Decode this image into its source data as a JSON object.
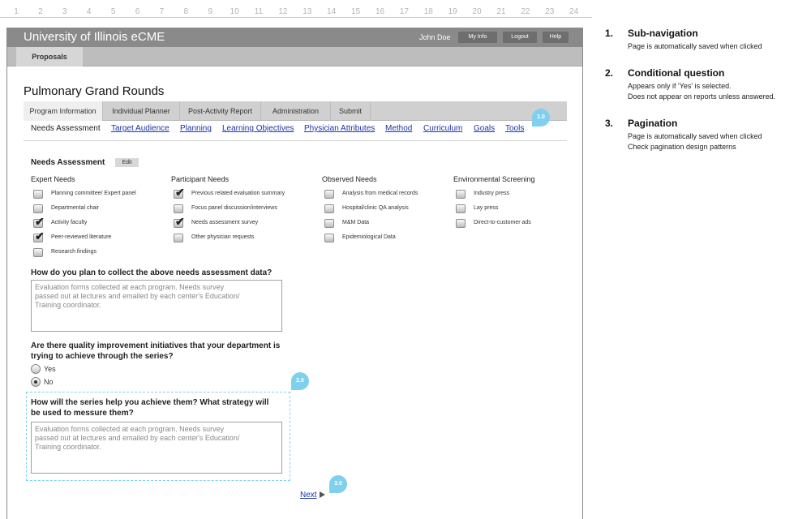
{
  "ruler": [
    "1",
    "2",
    "3",
    "4",
    "5",
    "6",
    "7",
    "8",
    "9",
    "10",
    "11",
    "12",
    "13",
    "14",
    "15",
    "16",
    "17",
    "18",
    "19",
    "20",
    "21",
    "22",
    "23",
    "24"
  ],
  "app": {
    "title": "University of Illinois eCME",
    "user": "John Doe",
    "buttons": [
      "My Info",
      "Logout",
      "Help"
    ],
    "section_tab": "Proposals"
  },
  "page_title": "Pulmonary Grand Rounds",
  "main_tabs": [
    {
      "label": "Program Information",
      "active": true
    },
    {
      "label": "Individual Planner",
      "active": false
    },
    {
      "label": "Post-Activity Report",
      "active": false
    },
    {
      "label": "Administration",
      "active": false
    },
    {
      "label": "Submit",
      "active": false
    }
  ],
  "sub_nav": [
    {
      "label": "Needs Assessment",
      "current": true
    },
    {
      "label": "Target Audience",
      "current": false
    },
    {
      "label": "Planning",
      "current": false
    },
    {
      "label": "Learning Objectives",
      "current": false
    },
    {
      "label": "Physician Attributes",
      "current": false
    },
    {
      "label": "Method",
      "current": false
    },
    {
      "label": "Curriculum",
      "current": false
    },
    {
      "label": "Goals",
      "current": false
    },
    {
      "label": "Tools",
      "current": false
    }
  ],
  "needs": {
    "title": "Needs Assessment",
    "edit_label": "Edit",
    "columns": [
      {
        "header": "Expert Needs",
        "items": [
          {
            "label": "Planning committee/ Expert panel",
            "checked": false
          },
          {
            "label": "Departmental chair",
            "checked": false
          },
          {
            "label": "Activity faculty",
            "checked": true
          },
          {
            "label": "Peer-reviewed literature",
            "checked": true
          },
          {
            "label": "Research findings",
            "checked": false
          }
        ]
      },
      {
        "header": "Participant Needs",
        "items": [
          {
            "label": "Previous related evaluation summary",
            "checked": true
          },
          {
            "label": "Focus panel discussion/interviews",
            "checked": false
          },
          {
            "label": "Needs assessment survey",
            "checked": true
          },
          {
            "label": "Other physician requests",
            "checked": false
          }
        ]
      },
      {
        "header": "Observed Needs",
        "items": [
          {
            "label": "Analysis from medical records",
            "checked": false
          },
          {
            "label": "Hospital/clinic QA analysis",
            "checked": false
          },
          {
            "label": "M&M Data",
            "checked": false
          },
          {
            "label": "Epidemiological Data",
            "checked": false
          }
        ]
      },
      {
        "header": "Environmental Screening",
        "items": [
          {
            "label": "Industry press",
            "checked": false
          },
          {
            "label": "Lay press",
            "checked": false
          },
          {
            "label": "Direct-to-customer ads",
            "checked": false
          }
        ]
      }
    ]
  },
  "q1": {
    "question": "How do you plan to collect the above needs assessment data?",
    "answer": "Evaluation forms collected at each program. Needs survey\npassed out at lectures and emailed by each center's Education/\nTraining coordinator."
  },
  "q2": {
    "question": "Are there quality improvement initiatives that your department is\ntrying to achieve through the series?",
    "options": [
      {
        "label": "Yes",
        "selected": false
      },
      {
        "label": "No",
        "selected": true
      }
    ]
  },
  "q3": {
    "question": "How will the series help you achieve them? What strategy will\nbe used to messure them?",
    "answer": "Evaluation forms collected at each program. Needs survey\npassed out at lectures and emailed by each center's Education/\nTraining coordinator."
  },
  "next_label": "Next",
  "markers": [
    "1.0",
    "2.0",
    "3.0"
  ],
  "notes": [
    {
      "num": "1.",
      "title": "Sub-navigation",
      "lines": [
        "Page is automatically saved when clicked"
      ]
    },
    {
      "num": "2.",
      "title": "Conditional question",
      "lines": [
        "Appears only if 'Yes' is selected.",
        "Does not appear on reports unless answered."
      ]
    },
    {
      "num": "3.",
      "title": "Pagination",
      "lines": [
        "Page is automatically saved when clicked",
        "Check pagination design patterns"
      ]
    }
  ],
  "colors": {
    "accent": "#7fd0ee",
    "link": "#1a33a8",
    "titlebar": "#8a8a8a"
  }
}
